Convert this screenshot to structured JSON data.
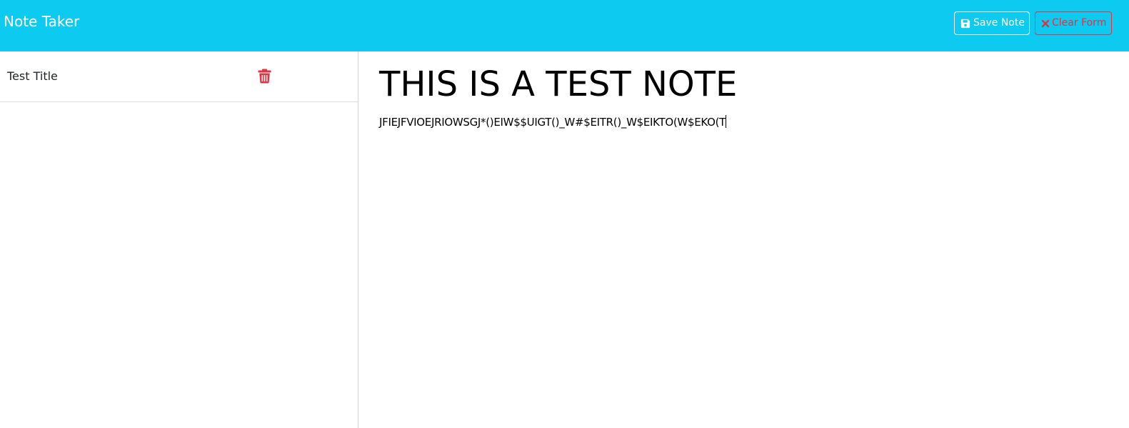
{
  "header": {
    "brand": "Note Taker",
    "save_label": "Save Note",
    "clear_label": "Clear Form"
  },
  "icons": {
    "save": "floppy-disk-icon",
    "clear": "x-mark-icon",
    "delete": "trash-icon"
  },
  "colors": {
    "navbar": "#0dcaf0",
    "danger": "#dc3545",
    "text": "#212529"
  },
  "sidebar": {
    "notes": [
      {
        "title": "Test Title"
      }
    ]
  },
  "editor": {
    "title": "THIS IS A TEST NOTE",
    "text": "JFIEJFVIOEJRIOWSGJ*()EIW$$UIGT()_W#$EITR()_W$EIKTO(W$EKO(T"
  }
}
